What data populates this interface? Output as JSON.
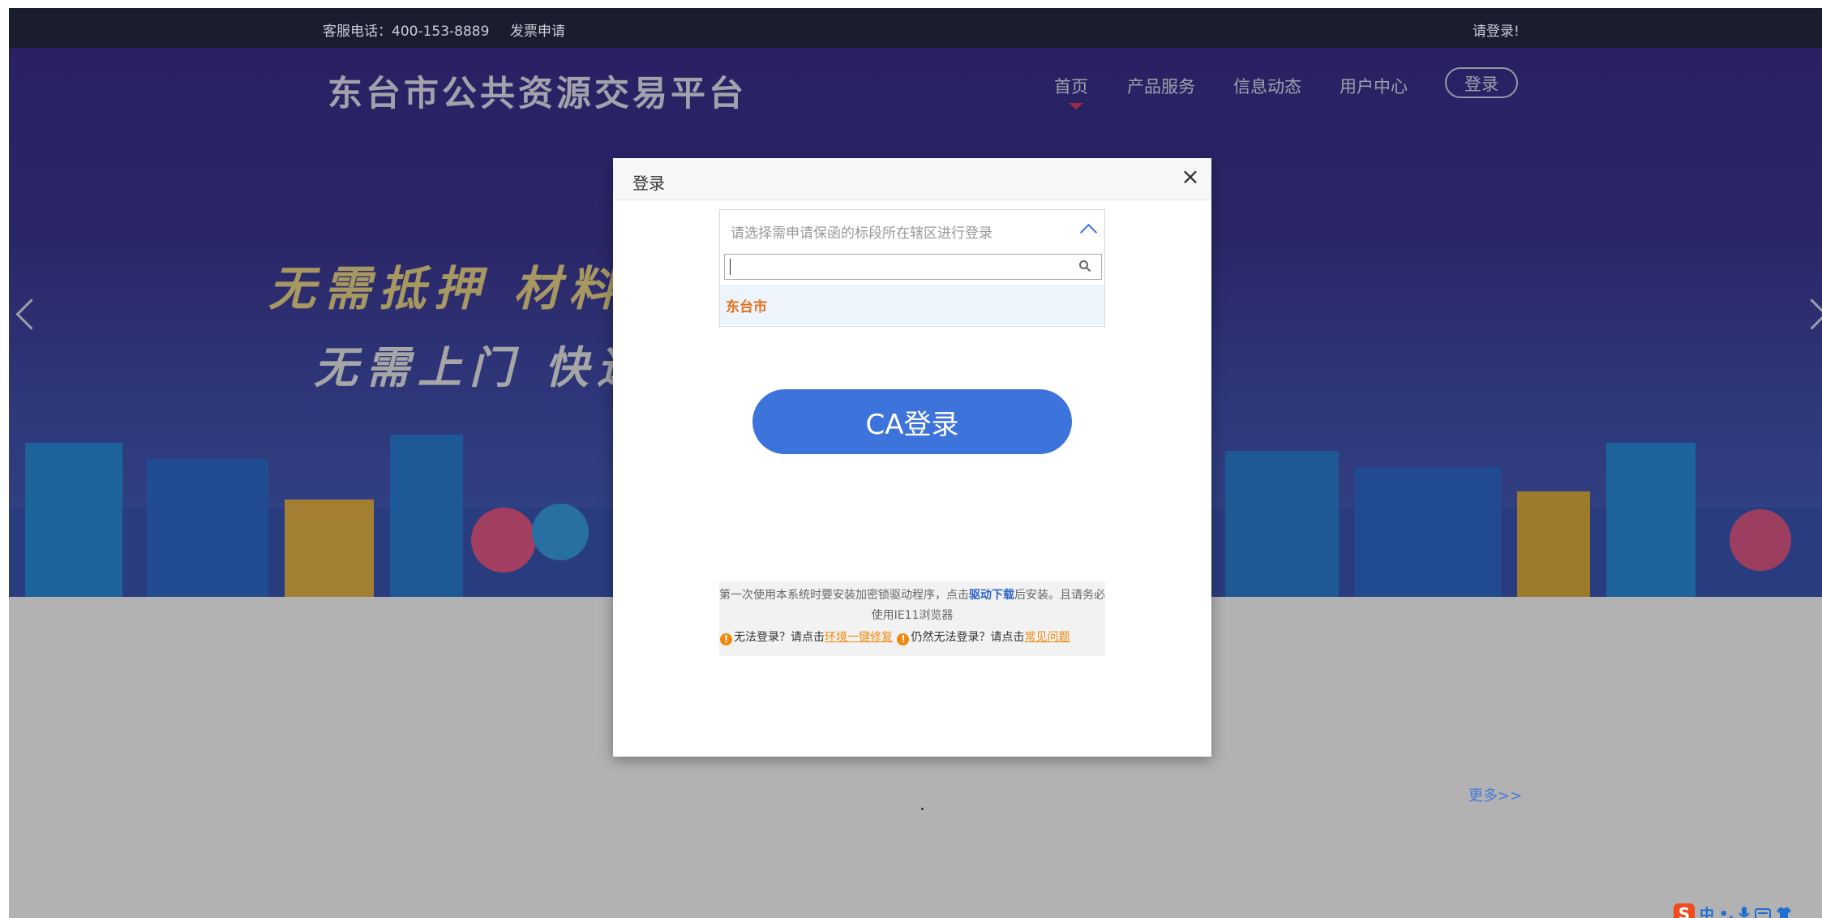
{
  "topbar": {
    "phone": "客服电话：400-153-8889",
    "invoice": "发票申请",
    "login_prompt": "请登录!"
  },
  "header": {
    "site_title": "东台市公共资源交易平台",
    "nav": {
      "home": "首页",
      "product": "产品服务",
      "news": "信息动态",
      "user": "用户中心",
      "login": "登录"
    }
  },
  "banner": {
    "slogan_line1": "无需抵押  材料简",
    "slogan_line2": "无需上门  快速"
  },
  "content": {
    "more": "更多>>"
  },
  "modal": {
    "title": "登录",
    "close": "×",
    "region_select": {
      "placeholder": "请选择需申请保函的标段所在辖区进行登录",
      "search_value": "",
      "options": [
        "东台市"
      ]
    },
    "ca_login": "CA登录",
    "notice": {
      "line1_pre": "第一次使用本系统时要安装加密锁驱动程序，点击",
      "driver_link": "驱动下载",
      "line1_post": "后安装。且请务必使用IE11浏览器",
      "cannot_login": "无法登录？请点击",
      "env_fix_link": "环境一键修复",
      "still_cannot": "仍然无法登录？请点击",
      "faq_link": "常见问题"
    }
  },
  "ime": {
    "logo": "S",
    "mode": "中",
    "punct": "•,"
  },
  "colors": {
    "accent_blue": "#3d74db",
    "link_orange": "#f08a0e",
    "topbar_bg": "#1a1d2d"
  }
}
